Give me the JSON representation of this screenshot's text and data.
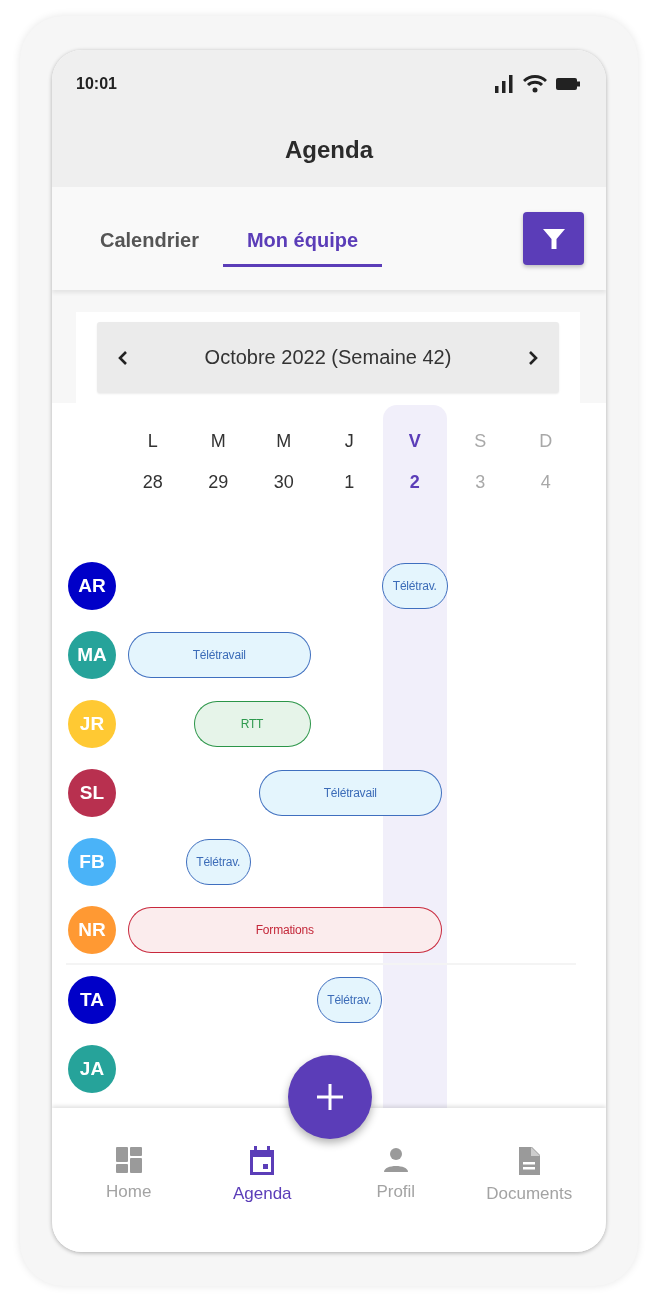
{
  "status_bar": {
    "time": "10:01"
  },
  "header": {
    "title": "Agenda"
  },
  "tabs": [
    {
      "label": "Calendrier",
      "selected": false
    },
    {
      "label": "Mon équipe",
      "selected": true
    }
  ],
  "week_nav": {
    "label": "Octobre 2022 (Semaine 42)"
  },
  "days": [
    {
      "letter": "L",
      "number": "28",
      "selected": false,
      "weekend": false
    },
    {
      "letter": "M",
      "number": "29",
      "selected": false,
      "weekend": false
    },
    {
      "letter": "M",
      "number": "30",
      "selected": false,
      "weekend": false
    },
    {
      "letter": "J",
      "number": "1",
      "selected": false,
      "weekend": false
    },
    {
      "letter": "V",
      "number": "2",
      "selected": true,
      "weekend": false
    },
    {
      "letter": "S",
      "number": "3",
      "selected": false,
      "weekend": true
    },
    {
      "letter": "D",
      "number": "4",
      "selected": false,
      "weekend": true
    }
  ],
  "groups": [
    {
      "members": [
        {
          "initials": "AR",
          "color": "#0000c8",
          "events": [
            {
              "label": "Télétrav.",
              "kind": "teletravail",
              "days": [
                false,
                false,
                false,
                false,
                true,
                false,
                false
              ]
            }
          ]
        },
        {
          "initials": "MA",
          "color": "#26a39a",
          "events": [
            {
              "label": "Télétravail",
              "kind": "teletravail",
              "days": [
                true,
                true,
                true,
                false,
                false,
                false,
                false
              ]
            }
          ]
        },
        {
          "initials": "JR",
          "color": "#ffc933",
          "events": [
            {
              "label": "RTT",
              "kind": "rtt",
              "days": [
                false,
                true,
                true,
                false,
                false,
                false,
                false
              ]
            }
          ]
        },
        {
          "initials": "SL",
          "color": "#b8304f",
          "events": [
            {
              "label": "Télétravail",
              "kind": "teletravail",
              "days": [
                false,
                false,
                true,
                true,
                true,
                false,
                false
              ]
            }
          ]
        },
        {
          "initials": "FB",
          "color": "#4ab3f8",
          "events": [
            {
              "label": "Télétrav.",
              "kind": "teletravail",
              "days": [
                false,
                true,
                false,
                false,
                false,
                false,
                false
              ]
            }
          ]
        },
        {
          "initials": "NR",
          "color": "#ff9933",
          "events": [
            {
              "label": "Formations",
              "kind": "formation",
              "days": [
                true,
                true,
                true,
                true,
                true,
                false,
                false
              ]
            }
          ]
        }
      ]
    },
    {
      "members": [
        {
          "initials": "TA",
          "color": "#0000c8",
          "events": [
            {
              "label": "Télétrav.",
              "kind": "teletravail",
              "days": [
                false,
                false,
                false,
                true,
                false,
                false,
                false
              ]
            }
          ]
        },
        {
          "initials": "JA",
          "color": "#26a39a"
        }
      ]
    }
  ],
  "bottom_nav": [
    {
      "label": "Home",
      "kind": "home",
      "selected": false
    },
    {
      "label": "Agenda",
      "kind": "agenda",
      "selected": true
    },
    {
      "label": "Profil",
      "kind": "profile",
      "selected": false
    },
    {
      "label": "Documents",
      "kind": "documents",
      "selected": false
    }
  ]
}
